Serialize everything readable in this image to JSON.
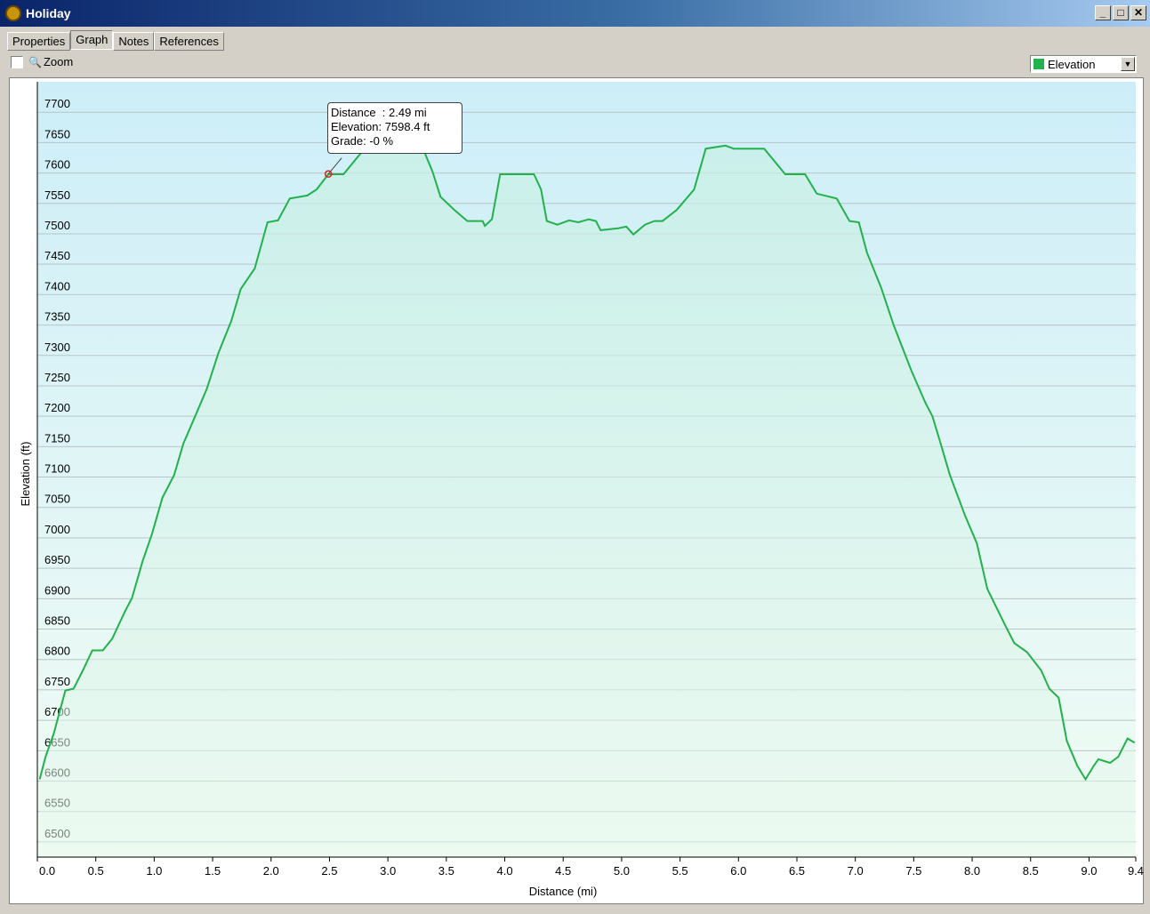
{
  "window": {
    "title": "Holiday",
    "buttons": [
      "_",
      "□",
      "✕"
    ]
  },
  "tabs": [
    {
      "label": "Properties"
    },
    {
      "label": "Graph",
      "active": true
    },
    {
      "label": "Notes"
    },
    {
      "label": "References"
    }
  ],
  "toolbar": {
    "zoom_label": "Zoom",
    "zoom_checked": false,
    "series_select": "Elevation",
    "series_color": "#22b14c"
  },
  "tooltip": {
    "distance": "Distance  : 2.49 mi",
    "elevation": "Elevation: 7598.4 ft",
    "grade": "Grade: -0 %"
  },
  "chart_data": {
    "type": "area",
    "xlabel": "Distance   (mi)",
    "ylabel": "Elevation (ft)",
    "xlim": [
      0,
      9.4
    ],
    "ylim": [
      6475,
      7750
    ],
    "xticks": [
      0.0,
      0.5,
      1.0,
      1.5,
      2.0,
      2.5,
      3.0,
      3.5,
      4.0,
      4.5,
      5.0,
      5.5,
      6.0,
      6.5,
      7.0,
      7.5,
      8.0,
      8.5,
      9.0,
      9.4
    ],
    "yticks": [
      6500,
      6550,
      6600,
      6650,
      6700,
      6750,
      6800,
      6850,
      6900,
      6950,
      7000,
      7050,
      7100,
      7150,
      7200,
      7250,
      7300,
      7350,
      7400,
      7450,
      7500,
      7550,
      7600,
      7650,
      7700
    ],
    "grid": true,
    "line_color": "#22b14c",
    "highlight": {
      "x": 2.49,
      "y": 7598.4
    },
    "x": [
      0.02,
      0.07,
      0.14,
      0.24,
      0.31,
      0.39,
      0.47,
      0.56,
      0.64,
      0.75,
      0.81,
      0.9,
      0.98,
      1.07,
      1.17,
      1.25,
      1.35,
      1.45,
      1.55,
      1.66,
      1.74,
      1.86,
      1.97,
      2.06,
      2.16,
      2.31,
      2.39,
      2.49,
      2.62,
      2.77,
      2.88,
      3.3,
      3.38,
      3.45,
      3.57,
      3.68,
      3.81,
      3.83,
      3.89,
      3.96,
      4.25,
      4.31,
      4.36,
      4.45,
      4.55,
      4.63,
      4.72,
      4.78,
      4.82,
      4.97,
      5.04,
      5.1,
      5.2,
      5.28,
      5.35,
      5.47,
      5.62,
      5.72,
      5.89,
      5.96,
      6.22,
      6.4,
      6.57,
      6.67,
      6.84,
      6.95,
      7.03,
      7.1,
      7.22,
      7.33,
      7.48,
      7.6,
      7.66,
      7.73,
      7.81,
      7.94,
      8.04,
      8.13,
      8.28,
      8.36,
      8.47,
      8.59,
      8.66,
      8.74,
      8.81,
      8.9,
      8.97,
      9.04,
      9.08,
      9.18,
      9.25,
      9.33,
      9.39
    ],
    "y": [
      6603,
      6640,
      6678,
      6749,
      6752,
      6782,
      6815,
      6815,
      6834,
      6879,
      6901,
      6961,
      7006,
      7066,
      7103,
      7155,
      7200,
      7245,
      7304,
      7357,
      7409,
      7443,
      7519,
      7522,
      7558,
      7563,
      7573,
      7598,
      7598,
      7633,
      7648,
      7640,
      7603,
      7561,
      7539,
      7521,
      7521,
      7513,
      7524,
      7598,
      7598,
      7573,
      7521,
      7515,
      7522,
      7519,
      7524,
      7521,
      7506,
      7509,
      7512,
      7499,
      7515,
      7521,
      7521,
      7539,
      7573,
      7640,
      7645,
      7640,
      7640,
      7598,
      7598,
      7566,
      7558,
      7521,
      7519,
      7469,
      7412,
      7349,
      7275,
      7222,
      7200,
      7155,
      7103,
      7036,
      6991,
      6916,
      6857,
      6827,
      6812,
      6782,
      6752,
      6737,
      6666,
      6625,
      6603,
      6625,
      6636,
      6630,
      6640,
      6670,
      6663
    ]
  }
}
